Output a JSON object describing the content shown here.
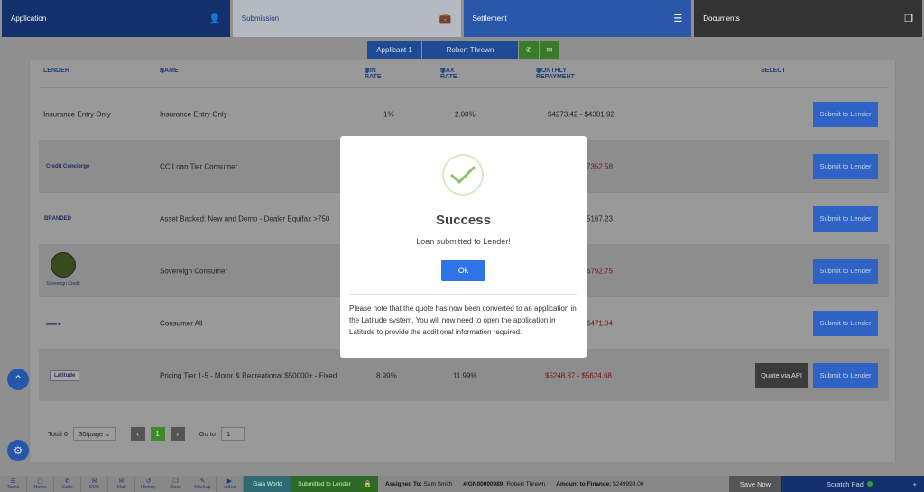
{
  "top_tabs": [
    {
      "label": "Application",
      "icon": "user-icon"
    },
    {
      "label": "Submission",
      "icon": "briefcase-icon"
    },
    {
      "label": "Settlement",
      "icon": "list-icon"
    },
    {
      "label": "Documents",
      "icon": "documents-icon"
    }
  ],
  "applicant_bar": {
    "applicant": "Applicant 1",
    "name": "Robert Threwn"
  },
  "table": {
    "headers": {
      "lender": "LENDER",
      "name": "NAME",
      "min_rate": "MIN RATE",
      "max_rate": "MAX RATE",
      "monthly": "MONTHLY REPAYMENT",
      "select": "SELECT"
    },
    "rows": [
      {
        "lender": "Insurance Entry Only",
        "name": "Insurance Entry Only",
        "min_rate": "1%",
        "max_rate": "2.00%",
        "monthly": "$4273.42 - $4381.92",
        "monthly_red": false,
        "quote": ""
      },
      {
        "lender": "Credit Concierge",
        "name": "CC Loan Tier Consumer",
        "min_rate": "",
        "max_rate": "",
        "monthly": "7352.58",
        "monthly_red": true,
        "quote": ""
      },
      {
        "lender": "BRANDED",
        "name": "Asset Backed: New and Demo - Dealer Equifax >750",
        "min_rate": "",
        "max_rate": "",
        "monthly": "5167.23",
        "monthly_red": false,
        "quote": ""
      },
      {
        "lender": "Sovereign Credit",
        "name": "Sovereign Consumer",
        "min_rate": "",
        "max_rate": "",
        "monthly": "6792.75",
        "monthly_red": true,
        "quote": ""
      },
      {
        "lender": "",
        "name": "Consumer All",
        "min_rate": "",
        "max_rate": "",
        "monthly": "6471.04",
        "monthly_red": true,
        "quote": ""
      },
      {
        "lender": "Latitude",
        "name": "Pricing Tier 1-5 - Motor & Recreational $50000+ - Fixed",
        "min_rate": "8.99%",
        "max_rate": "11.99%",
        "monthly": "$5248.87 - $5624.68",
        "monthly_red": true,
        "quote": "Quote via API"
      }
    ],
    "submit_label": "Submit to Lender"
  },
  "pager": {
    "total": "Total 6",
    "per_page": "30/page",
    "current": "1",
    "goto_label": "Go to",
    "goto_value": "1"
  },
  "modal": {
    "title": "Success",
    "message": "Loan submitted to Lender!",
    "ok": "Ok",
    "note": "Please note that the quote has now been converted to an application in the Latitude system. You will now need to open the application in Latitude to provide the additional information required."
  },
  "bottom_bar": {
    "items": [
      {
        "label": "Tasks",
        "icon": "☰"
      },
      {
        "label": "Notes",
        "icon": "▢"
      },
      {
        "label": "Calls",
        "icon": "✆"
      },
      {
        "label": "SMS",
        "icon": "✉"
      },
      {
        "label": "Mail",
        "icon": "✉"
      },
      {
        "label": "History",
        "icon": "↺"
      },
      {
        "label": "Docs",
        "icon": "❐"
      },
      {
        "label": "Markup",
        "icon": "✎"
      },
      {
        "label": "Video",
        "icon": "▶"
      }
    ],
    "world": "Gaia World",
    "status": "Submitted to Lender",
    "assigned_label": "Assigned To:",
    "assigned_value": "Sam Smith",
    "ign": "#IGN00000989:",
    "client": "Robert Threwn",
    "amount_label": "Amount to Finance:",
    "amount_value": "$249999.00",
    "save": "Save Now",
    "scratch": "Scratch Pad",
    "plus": "+"
  }
}
